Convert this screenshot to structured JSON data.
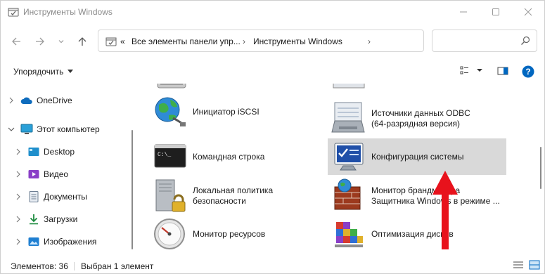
{
  "window": {
    "title": "Инструменты Windows"
  },
  "address": {
    "overflow": "«",
    "crumb1": "Все элементы панели упр...",
    "sep1": "›",
    "crumb2": "Инструменты Windows",
    "sep2": "›",
    "search_placeholder": ""
  },
  "commands": {
    "sort_label": "Упорядочить"
  },
  "nav": {
    "items": [
      {
        "label": "OneDrive",
        "icon": "cloud-icon",
        "indent": 0,
        "expanded": false
      },
      {
        "label": "Этот компьютер",
        "icon": "computer-icon",
        "indent": 0,
        "expanded": true
      },
      {
        "label": "Desktop",
        "icon": "desktop-icon",
        "indent": 1,
        "expanded": false
      },
      {
        "label": "Видео",
        "icon": "video-icon",
        "indent": 1,
        "expanded": false
      },
      {
        "label": "Документы",
        "icon": "documents-icon",
        "indent": 1,
        "expanded": false
      },
      {
        "label": "Загрузки",
        "icon": "downloads-icon",
        "indent": 1,
        "expanded": false
      },
      {
        "label": "Изображения",
        "icon": "pictures-icon",
        "indent": 1,
        "expanded": false
      }
    ]
  },
  "tiles": [
    {
      "id": "iscsi",
      "label": "Инициатор iSCSI",
      "icon": "globe-icon"
    },
    {
      "id": "odbc",
      "label": "Источники данных ODBC\n(64-разрядная версия)",
      "icon": "odbc-icon"
    },
    {
      "id": "cmd",
      "label": "Командная строка",
      "icon": "console-icon"
    },
    {
      "id": "msconfig",
      "label": "Конфигурация системы",
      "icon": "system-config-icon",
      "selected": true
    },
    {
      "id": "secpol",
      "label": "Локальная политика\nбезопасности",
      "icon": "security-policy-icon"
    },
    {
      "id": "firewall",
      "label": "Монитор брандмауэра\nЗащитника Windows в режиме ...",
      "icon": "firewall-icon"
    },
    {
      "id": "resmon",
      "label": "Монитор ресурсов",
      "icon": "gauge-icon"
    },
    {
      "id": "defrag",
      "label": "Оптимизация дисков",
      "icon": "defrag-icon"
    }
  ],
  "status": {
    "count": "Элементов: 36",
    "selected": "Выбран 1 элемент"
  },
  "colors": {
    "accent": "#0067c0",
    "selection": "#d9d9d9",
    "annotation_arrow": "#e8121c"
  }
}
